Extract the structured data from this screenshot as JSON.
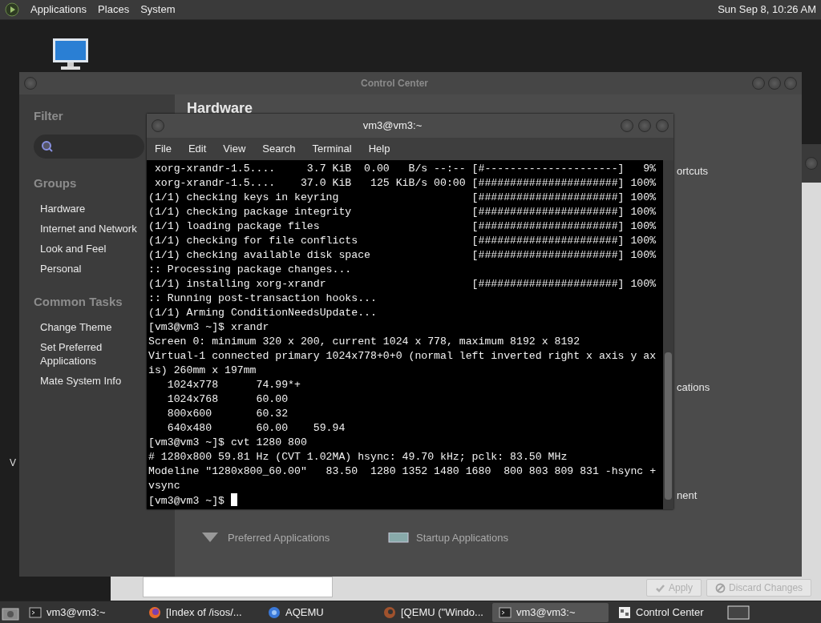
{
  "top_panel": {
    "menus": [
      "Applications",
      "Places",
      "System"
    ],
    "clock": "Sun Sep  8, 10:26 AM"
  },
  "desktop": {
    "partial_label": "V"
  },
  "background_window": {
    "buttons": [
      {
        "label": "Apply",
        "kind": "apply",
        "disabled": true
      },
      {
        "label": "Discard Changes",
        "kind": "discard",
        "disabled": true
      }
    ]
  },
  "control_center": {
    "title": "Control Center",
    "filter": {
      "heading": "Filter"
    },
    "groups": {
      "heading": "Groups",
      "items": [
        "Hardware",
        "Internet and Network",
        "Look and Feel",
        "Personal"
      ]
    },
    "common_tasks": {
      "heading": "Common Tasks",
      "items": [
        "Change Theme",
        "Set Preferred Applications",
        "Mate System Info"
      ]
    },
    "content": {
      "heading": "Hardware",
      "fragments": [
        "ortcuts",
        "cations",
        "nent"
      ],
      "launchers": [
        "Preferred Applications",
        "Startup Applications"
      ]
    }
  },
  "terminal": {
    "title": "vm3@vm3:~",
    "menu": [
      "File",
      "Edit",
      "View",
      "Search",
      "Terminal",
      "Help"
    ],
    "lines": [
      " xorg-xrandr-1.5....     3.7 KiB  0.00   B/s --:-- [#---------------------]   9%",
      " xorg-xrandr-1.5....    37.0 KiB   125 KiB/s 00:00 [######################] 100%",
      "(1/1) checking keys in keyring                     [######################] 100%",
      "(1/1) checking package integrity                   [######################] 100%",
      "(1/1) loading package files                        [######################] 100%",
      "(1/1) checking for file conflicts                  [######################] 100%",
      "(1/1) checking available disk space                [######################] 100%",
      ":: Processing package changes...",
      "(1/1) installing xorg-xrandr                       [######################] 100%",
      ":: Running post-transaction hooks...",
      "(1/1) Arming ConditionNeedsUpdate...",
      "[vm3@vm3 ~]$ xrandr",
      "Screen 0: minimum 320 x 200, current 1024 x 778, maximum 8192 x 8192",
      "Virtual-1 connected primary 1024x778+0+0 (normal left inverted right x axis y ax",
      "is) 260mm x 197mm",
      "   1024x778      74.99*+",
      "   1024x768      60.00",
      "   800x600       60.32",
      "   640x480       60.00    59.94",
      "[vm3@vm3 ~]$ cvt 1280 800",
      "# 1280x800 59.81 Hz (CVT 1.02MA) hsync: 49.70 kHz; pclk: 83.50 MHz",
      "Modeline \"1280x800_60.00\"   83.50  1280 1352 1480 1680  800 803 809 831 -hsync +",
      "vsync",
      "[vm3@vm3 ~]$ "
    ]
  },
  "taskbar": {
    "items": [
      {
        "label": "vm3@vm3:~",
        "kind": "terminal",
        "selected": false
      },
      {
        "label": "[Index of /isos/...",
        "kind": "browser",
        "selected": false
      },
      {
        "label": "AQEMU",
        "kind": "aqemu",
        "selected": false
      },
      {
        "label": "[QEMU (\"Windo...",
        "kind": "qemu",
        "selected": false
      },
      {
        "label": "vm3@vm3:~",
        "kind": "terminal",
        "selected": true
      },
      {
        "label": "Control Center",
        "kind": "control",
        "selected": false
      }
    ]
  }
}
